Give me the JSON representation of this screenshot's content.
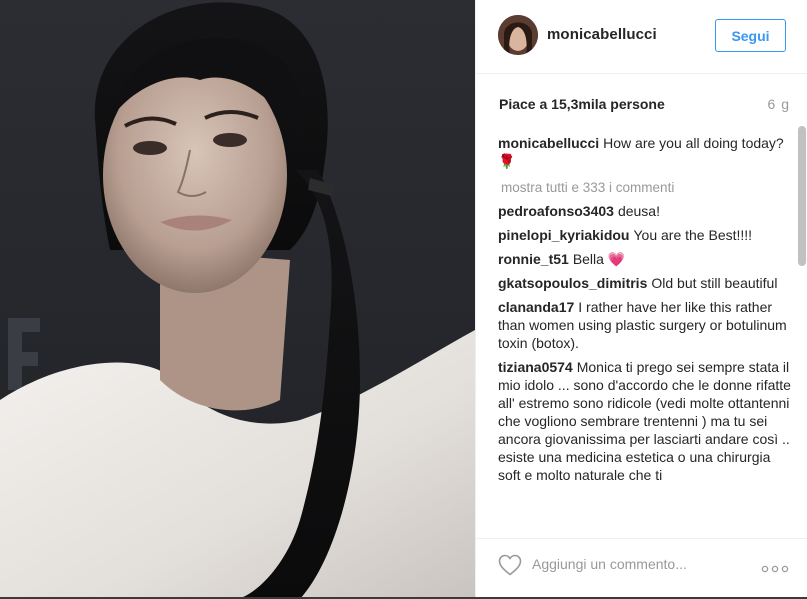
{
  "header": {
    "username": "monicabellucci",
    "follow_label": "Segui"
  },
  "likes": {
    "text": "Piace a 15,3mila persone",
    "time": "6 g"
  },
  "caption": {
    "user": "monicabellucci",
    "text": "How are you all doing today?",
    "emoji": "🌹"
  },
  "more_comments": "mostra tutti e 333 i commenti",
  "comments": [
    {
      "user": "pedroafonso3403",
      "text": "deusa!"
    },
    {
      "user": "pinelopi_kyriakidou",
      "text": "You are the Best!!!!"
    },
    {
      "user": "ronnie_t51",
      "text": "Bella 💗"
    },
    {
      "user": "gkatsopoulos_dimitris",
      "text": "Old but still beautiful"
    },
    {
      "user": "clananda17",
      "text": "I rather have her like this rather than women using plastic surgery or botulinum toxin (botox)."
    },
    {
      "user": "tiziana0574",
      "text": "Monica ti prego sei sempre stata il mio idolo ... sono d'accordo che le donne rifatte all' estremo sono ridicole (vedi molte ottantenni che vogliono sembrare trentenni ) ma tu sei ancora giovanissima per lasciarti andare così .. esiste una medicina estetica o una chirurgia soft e molto naturale che ti"
    }
  ],
  "footer": {
    "comment_placeholder": "Aggiungi un commento...",
    "heart_icon": "heart-outline",
    "more_icon": "ellipsis"
  },
  "colors": {
    "accent": "#3897f0",
    "text": "#262626",
    "muted": "#999999"
  }
}
